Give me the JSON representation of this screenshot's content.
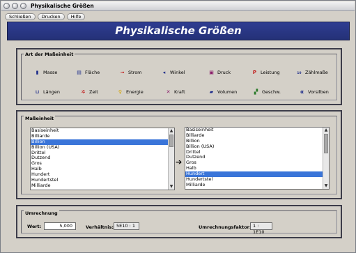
{
  "window": {
    "title": "Physikalische Größen"
  },
  "menu": {
    "items": [
      "Schließen",
      "Drucken",
      "Hilfe"
    ]
  },
  "banner": {
    "title": "Physikalische Größen"
  },
  "units_group": {
    "legend": "Art der Maßeinheit",
    "items": [
      {
        "label": "Masse",
        "icon": "weight-icon"
      },
      {
        "label": "Fläche",
        "icon": "area-icon"
      },
      {
        "label": "Strom",
        "icon": "current-icon"
      },
      {
        "label": "Winkel",
        "icon": "angle-icon"
      },
      {
        "label": "Druck",
        "icon": "pressure-icon"
      },
      {
        "label": "Leistung",
        "icon": "power-icon"
      },
      {
        "label": "Zählmaße",
        "icon": "count-icon"
      },
      {
        "label": "Längen",
        "icon": "ruler-icon"
      },
      {
        "label": "Zeit",
        "icon": "clock-icon"
      },
      {
        "label": "Energie",
        "icon": "bulb-icon"
      },
      {
        "label": "Kraft",
        "icon": "force-icon"
      },
      {
        "label": "Volumen",
        "icon": "volume-icon"
      },
      {
        "label": "Geschw.",
        "icon": "speed-icon"
      },
      {
        "label": "Vorsilben",
        "icon": "prefix-icon"
      }
    ]
  },
  "measure_group": {
    "legend": "Maßeinheit",
    "left_list": {
      "items": [
        "Basiseinheit",
        "Billiarde",
        "Billion",
        "Billion (USA)",
        "Drittel",
        "Dutzend",
        "Gros",
        "Halb",
        "Hundert",
        "Hundertstel",
        "Milliarde"
      ],
      "selected": "Billion"
    },
    "right_list": {
      "items": [
        "Basiseinheit",
        "Billiarde",
        "Billion",
        "Billion (USA)",
        "Drittel",
        "Dutzend",
        "Gros",
        "Halb",
        "Hundert",
        "Hundertstel",
        "Milliarde"
      ],
      "selected": "Hundert"
    },
    "arrow": "➔"
  },
  "conversion": {
    "legend": "Umrechnung",
    "value_label": "Wert:",
    "value": "5,000",
    "ratio_label": "Verhältnis:",
    "ratio": "5E10 : 1",
    "factor_label": "Umrechnungsfaktor:",
    "factor": "1 : 1E10"
  },
  "colors": {
    "banner": "#2b3889",
    "selection": "#3a75d9"
  }
}
